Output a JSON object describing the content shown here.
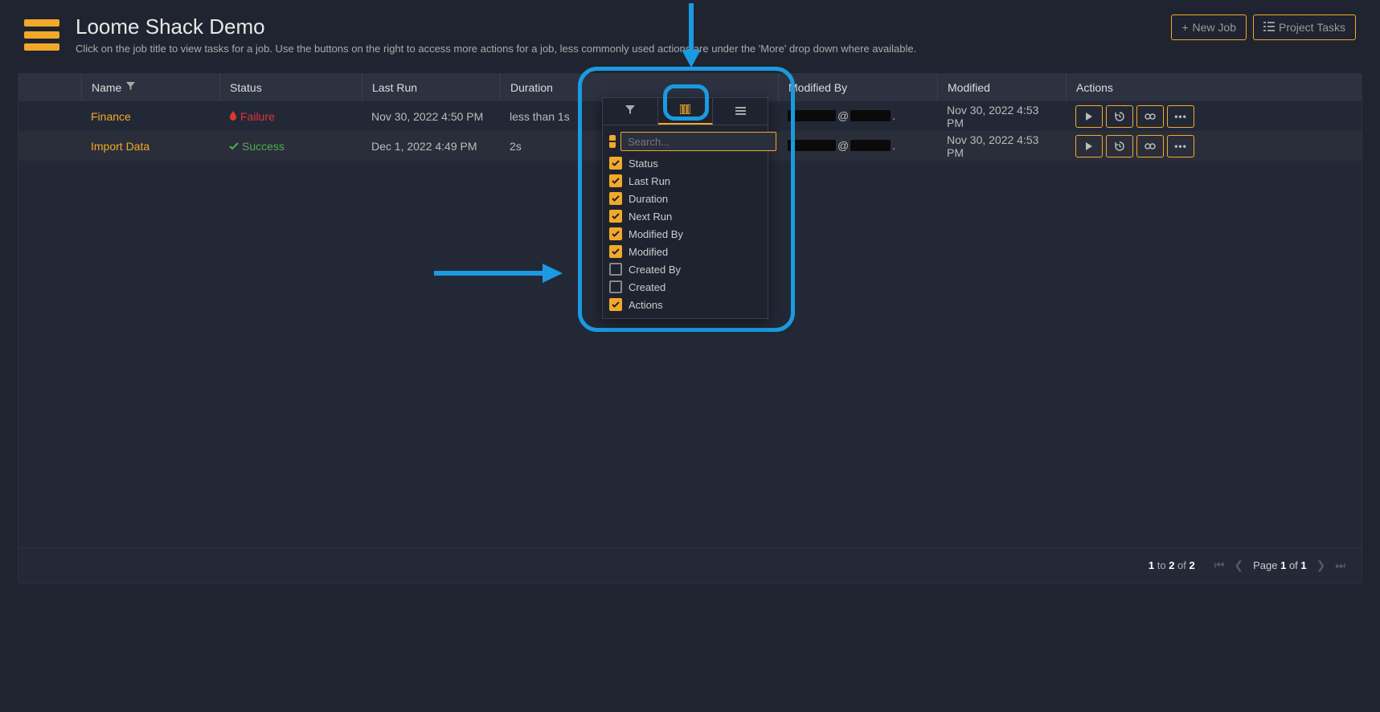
{
  "header": {
    "title": "Loome Shack Demo",
    "subtitle": "Click on the job title to view tasks for a job. Use the buttons on the right to access more actions for a job, less commonly used actions are under the 'More' drop down where available.",
    "new_job_label": "New Job",
    "project_tasks_label": "Project Tasks"
  },
  "columns": {
    "name": "Name",
    "status": "Status",
    "last_run": "Last Run",
    "duration": "Duration",
    "modified_by": "Modified By",
    "modified": "Modified",
    "actions": "Actions"
  },
  "rows": [
    {
      "name": "Finance",
      "status": "Failure",
      "status_type": "failure",
      "last_run": "Nov 30, 2022 4:50 PM",
      "duration": "less than 1s",
      "modified_by_at": "@",
      "modified": "Nov 30, 2022 4:53 PM"
    },
    {
      "name": "Import Data",
      "status": "Success",
      "status_type": "success",
      "last_run": "Dec 1, 2022 4:49 PM",
      "duration": "2s",
      "modified_by_at": "@",
      "modified": "Nov 30, 2022 4:53 PM"
    }
  ],
  "footer": {
    "count_prefix": "1",
    "count_to": "to",
    "count_mid": "2",
    "count_of": "of",
    "count_total": "2",
    "page_label_prefix": "Page",
    "page_current": "1",
    "page_of": "of",
    "page_total": "1"
  },
  "dropdown": {
    "search_placeholder": "Search...",
    "options": [
      {
        "label": "Status",
        "checked": true
      },
      {
        "label": "Last Run",
        "checked": true
      },
      {
        "label": "Duration",
        "checked": true
      },
      {
        "label": "Next Run",
        "checked": true
      },
      {
        "label": "Modified By",
        "checked": true
      },
      {
        "label": "Modified",
        "checked": true
      },
      {
        "label": "Created By",
        "checked": false
      },
      {
        "label": "Created",
        "checked": false
      },
      {
        "label": "Actions",
        "checked": true
      }
    ]
  }
}
